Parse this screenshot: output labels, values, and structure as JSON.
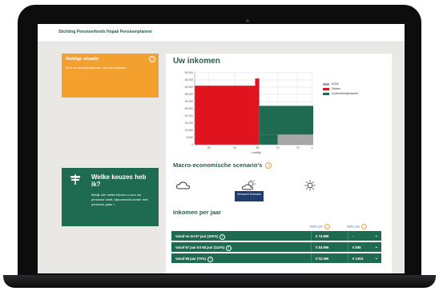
{
  "header": {
    "site_title": "Stichting Pensioenfonds Hopak Pensioenplanner"
  },
  "current_situation": {
    "title": "Huidige situatie",
    "subtitle": "Uit a de pensioenplanner van uw pensioen"
  },
  "choices_card": {
    "title": "Welke keuzes heb ik?",
    "description": "Bekijk hier welke keuzes u voor uw pensioen heeft, bijvoorbeeld eerder met pensioen gaan >"
  },
  "income": {
    "title": "Uw inkomen",
    "chart_data": {
      "type": "area",
      "xlabel": "Leeftijd",
      "ylabel": "",
      "x_ticks": [
        "50",
        "60",
        "65",
        "70",
        "75",
        "≥"
      ],
      "y_ticks": [
        "0",
        "5.000",
        "10.000",
        "15.000",
        "20.000",
        "25.000",
        "30.000",
        "35.000",
        "40.000",
        "45.000",
        "50.000"
      ],
      "ylim": [
        0,
        50000
      ],
      "series": [
        {
          "name": "AOW",
          "color": "#a7a7a7"
        },
        {
          "name": "Salaris",
          "color": "#e0141e"
        },
        {
          "name": "Ouderdomspensioen",
          "color": "#1f6b52"
        }
      ],
      "legend_position": "right"
    }
  },
  "scenarios": {
    "title": "Macro-economische scenario's",
    "active_label": "Verwacht Scenario",
    "icons": [
      "cloud-icon",
      "partly-sunny-icon",
      "sun-icon"
    ]
  },
  "income_per_year": {
    "title": "Inkomen per jaar",
    "columns": [
      "Netto per",
      "Netto per"
    ],
    "rows": [
      {
        "label": "Vanaf nu tot 67 jaar (100%)",
        "v1": "€ 74.888",
        "v2": "-"
      },
      {
        "label": "Vanaf 67 jaar tot 68 jaar (114%)",
        "v1": "€ 84.996",
        "v2": "€ 849"
      },
      {
        "label": "Vanaf 68 jaar (70%)",
        "v1": "€ 52.396",
        "v2": "€ 3.811"
      }
    ]
  },
  "colors": {
    "brand_green": "#1f6b52",
    "accent_orange": "#f4a02f",
    "salary_red": "#e0141e",
    "aow_grey": "#a7a7a7"
  }
}
